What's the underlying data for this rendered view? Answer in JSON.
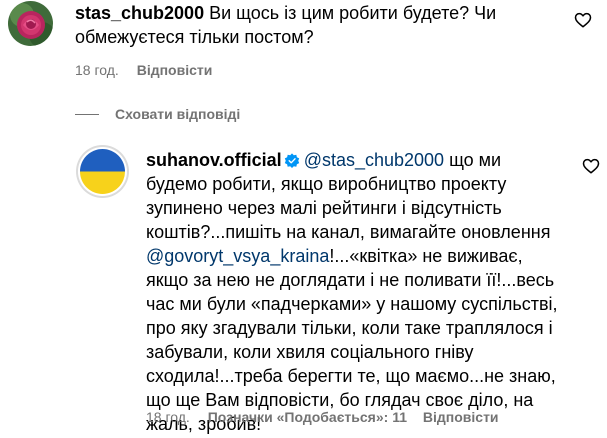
{
  "comment1": {
    "username": "stas_chub2000",
    "text": "Ви щось із цим робити будете? Чи обмежуєтеся тільки постом?",
    "time": "18 год.",
    "reply_label": "Відповісти"
  },
  "hide_replies_label": "Сховати відповіді",
  "comment2": {
    "username": "suhanov.official",
    "mention1": "@stas_chub2000",
    "text_part1": " що ми будемо робити, якщо виробництво проекту зупинено через малі рейтинги і відсутність коштів?...пишіть на канал, вимагайте оновлення ",
    "mention2": "@govoryt_vsya_kraina",
    "text_part2": "!...«квітка» не виживає, якщо за нею не доглядати і не поливати її!...весь час ми були «падчерками» у нашому суспільстві, про яку згадували тільки, коли таке траплялося і забували, коли хвиля соціального гніву сходила!...треба берегти те, що маємо...не знаю, що ще Вам відповісти, бо глядач своє діло, на жаль, зробив!",
    "time": "18 год.",
    "likes_label": "Позначки «Подобається»: 11",
    "reply_label": "Відповісти"
  },
  "icons": {
    "heart": "heart-outline-icon",
    "verified": "verified-badge-icon",
    "avatar1": "rose-flower-avatar",
    "avatar2": "ukraine-flag-avatar"
  },
  "colors": {
    "secondary_text": "#737373",
    "mention": "#00376b",
    "verified": "#0095f6",
    "flag_blue": "#1f5fbf",
    "flag_yellow": "#f7d21b"
  }
}
